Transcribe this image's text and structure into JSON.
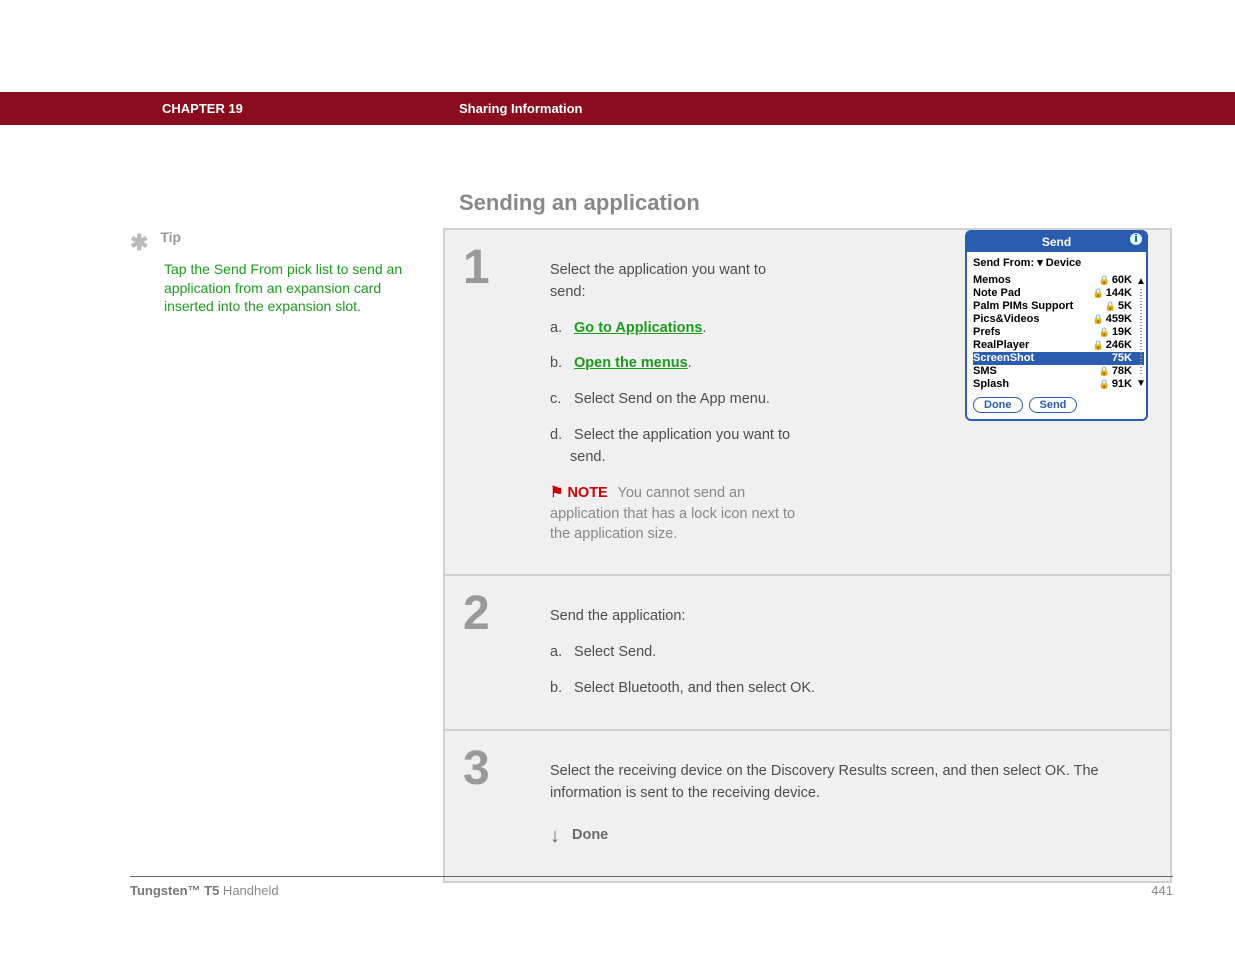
{
  "header": {
    "chapter": "CHAPTER 19",
    "topic": "Sharing Information"
  },
  "section_title": "Sending an application",
  "tip": {
    "label": "Tip",
    "text": "Tap the Send From pick list to send an application from an expansion card inserted into the expansion slot."
  },
  "steps": [
    {
      "num": "1",
      "intro": "Select the application you want to send:",
      "subs": [
        {
          "letter": "a.",
          "prefix": "",
          "link": "Go to Applications",
          "suffix": "."
        },
        {
          "letter": "b.",
          "prefix": "",
          "link": "Open the menus",
          "suffix": "."
        },
        {
          "letter": "c.",
          "prefix": "Select Send on the App menu.",
          "link": "",
          "suffix": ""
        },
        {
          "letter": "d.",
          "prefix": "Select the application you want to send.",
          "link": "",
          "suffix": ""
        }
      ],
      "note": {
        "label": "NOTE",
        "text": "You cannot send an application that has a lock icon next to the application size."
      }
    },
    {
      "num": "2",
      "intro": "Send the application:",
      "subs": [
        {
          "letter": "a.",
          "prefix": "Select Send.",
          "link": "",
          "suffix": ""
        },
        {
          "letter": "b.",
          "prefix": "Select Bluetooth, and then select OK.",
          "link": "",
          "suffix": ""
        }
      ]
    },
    {
      "num": "3",
      "intro_full": "Select the receiving device on the Discovery Results screen, and then select OK. The information is sent to the receiving device.",
      "done": "Done"
    }
  ],
  "palm": {
    "title": "Send",
    "from_label": "Send From:",
    "from_value": "Device",
    "rows": [
      {
        "name": "Memos",
        "lock": true,
        "size": "60K"
      },
      {
        "name": "Note Pad",
        "lock": true,
        "size": "144K"
      },
      {
        "name": "Palm PIMs Support",
        "lock": true,
        "size": "5K"
      },
      {
        "name": "Pics&Videos",
        "lock": true,
        "size": "459K"
      },
      {
        "name": "Prefs",
        "lock": true,
        "size": "19K"
      },
      {
        "name": "RealPlayer",
        "lock": true,
        "size": "246K"
      },
      {
        "name": "ScreenShot",
        "lock": false,
        "size": "75K",
        "selected": true
      },
      {
        "name": "SMS",
        "lock": true,
        "size": "78K"
      },
      {
        "name": "Splash",
        "lock": true,
        "size": "91K"
      }
    ],
    "buttons": {
      "done": "Done",
      "send": "Send"
    }
  },
  "footer": {
    "product_bold": "Tungsten™ T5",
    "product_rest": " Handheld",
    "page": "441"
  }
}
